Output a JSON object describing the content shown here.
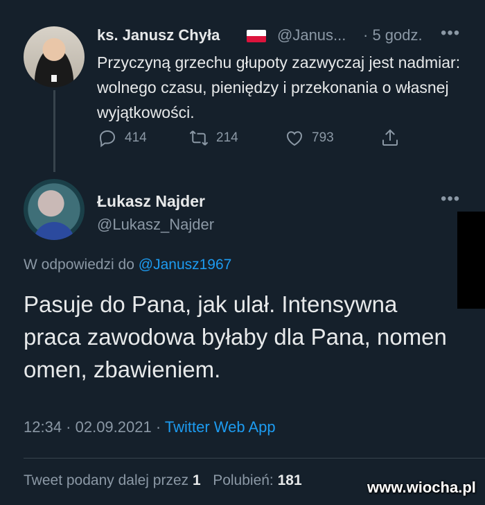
{
  "parent": {
    "name": "ks. Janusz Chyła",
    "handle": "@Janus...",
    "time": "· 5 godz.",
    "more": "•••",
    "text": "Przyczyną grzechu głupoty zazwyczaj jest nadmiar: wolnego czasu, pieniędzy i przekonania o własnej wyjątkowości.",
    "actions": {
      "replies": "414",
      "retweets": "214",
      "likes": "793"
    }
  },
  "reply": {
    "name": "Łukasz Najder",
    "handle": "@Lukasz_Najder",
    "more": "•••",
    "reply_prefix": "W odpowiedzi do",
    "reply_to": "@Janusz1967",
    "text": "Pasuje do Pana, jak ulał. Intensywna praca zawodowa byłaby dla Pana, nomen omen, zbawieniem.",
    "time": "12:34 · 02.09.2021 ·",
    "source": "Twitter Web App",
    "retweets_label": "Tweet podany dalej przez",
    "retweets_count": "1",
    "likes_label": "Polubień:",
    "likes_count": "181"
  },
  "watermark": "www.wiocha.pl",
  "colors": {
    "background": "#15202b",
    "link": "#1d9bf0",
    "muted": "#8b98a5"
  }
}
